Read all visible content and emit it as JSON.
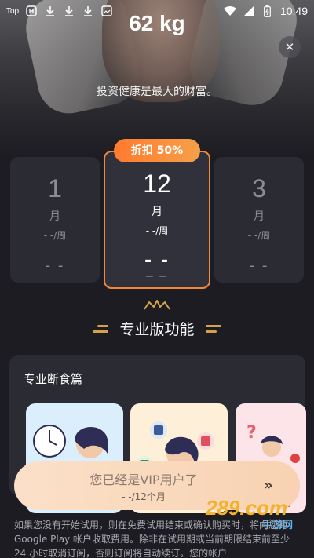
{
  "status_bar": {
    "left_tag": "Top",
    "left_icons": [
      "app-icon",
      "download-icon",
      "download-icon",
      "download-icon",
      "image-icon"
    ],
    "right_icons": [
      "wifi-icon",
      "signal-icon",
      "battery-icon"
    ],
    "time": "10:49"
  },
  "header": {
    "weight": "62 kg",
    "tagline": "投资健康是最大的财富。"
  },
  "plans": [
    {
      "number": "1",
      "unit": "月",
      "per_week": "- -/周",
      "price": "- -"
    },
    {
      "number": "12",
      "unit": "月",
      "per_week": "- -/周",
      "price": "- -",
      "sub": "— —"
    },
    {
      "number": "3",
      "unit": "月",
      "per_week": "- -/周",
      "price": "- -"
    }
  ],
  "badge": "折扣 50%",
  "pro_section": {
    "title": "专业版功能",
    "accent_color": "#d4a24a"
  },
  "panel": {
    "title": "专业断食篇",
    "cards": [
      "clock-girl-illustration",
      "app-girl-illustration",
      "question-person-illustration"
    ]
  },
  "cta": {
    "label": "您已经是VIP用户了",
    "sub": "- -/12个月",
    "arrow": "»"
  },
  "disclaimer": "如果您没有开始试用，则在免费试用结束或确认购买时，将向您的 Google Play 帐户收取费用。除非在试用期或当前期限结束前至少 24 小时取消订阅，否则订阅将自动续订。您的帐户",
  "watermark": {
    "main": "289.com",
    "sub": "手游网"
  },
  "colors": {
    "background": "#1c1c22",
    "card": "#2b2b33",
    "highlight_border": "#f08a3a",
    "badge_start": "#ff7a2e",
    "badge_end": "#f6a04a",
    "cta_start": "#fbe0c8",
    "cta_end": "#f8d2b2"
  }
}
